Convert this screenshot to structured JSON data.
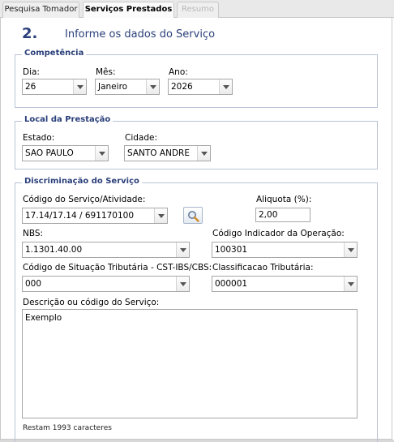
{
  "tabs": [
    {
      "label": "Pesquisa Tomador"
    },
    {
      "label": "Serviços Prestados"
    },
    {
      "label": "Resumo"
    }
  ],
  "step": {
    "number": "2.",
    "title": "Informe os dados do Serviço"
  },
  "competencia": {
    "legend": "Competência",
    "dia_label": "Dia:",
    "dia_value": "26",
    "mes_label": "Mês:",
    "mes_value": "Janeiro",
    "ano_label": "Ano:",
    "ano_value": "2026"
  },
  "local": {
    "legend": "Local da Prestação",
    "estado_label": "Estado:",
    "estado_value": "SAO PAULO",
    "cidade_label": "Cidade:",
    "cidade_value": "SANTO ANDRE"
  },
  "discriminacao": {
    "legend": "Discriminação do Serviço",
    "codigo_label": "Código do Serviço/Atividade:",
    "codigo_value": "17.14/17.14 / 691170100",
    "aliquota_label": "Aliquota (%):",
    "aliquota_value": "2,00",
    "nbs_label": "NBS:",
    "nbs_value": "1.1301.40.00",
    "indicador_label": "Código Indicador da Operação:",
    "indicador_value": "100301",
    "cst_label": "Código de Situação Tributária - CST-IBS/CBS:",
    "cst_value": "000",
    "classificacao_label": "Classificacao Tributária:",
    "classificacao_value": "000001",
    "descricao_label": "Descrição ou código do Serviço:",
    "descricao_value": "Exemplo",
    "remaining": "Restam 1993 caracteres"
  },
  "icons": {
    "lookup": "magnifier-icon",
    "dropdown": "chevron-down-icon"
  },
  "colors": {
    "heading": "#2a3f7a",
    "fieldset_border": "#b7c3d6"
  }
}
